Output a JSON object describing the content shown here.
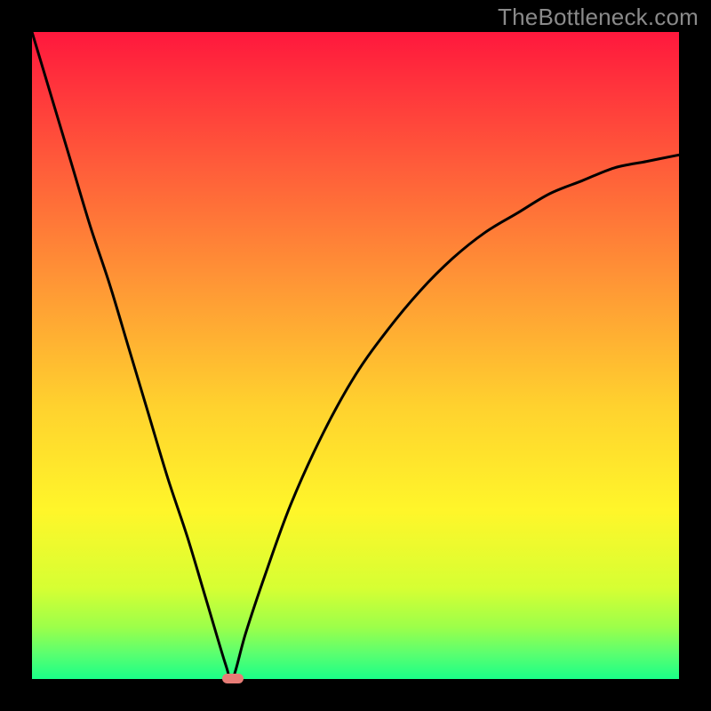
{
  "watermark": "TheBottleneck.com",
  "colors": {
    "frame": "#000000",
    "line": "#000000",
    "marker": "#e77c76",
    "gradient_stops": [
      {
        "offset": 0.0,
        "color": "#ff183d"
      },
      {
        "offset": 0.2,
        "color": "#ff5a3a"
      },
      {
        "offset": 0.4,
        "color": "#ff9a35"
      },
      {
        "offset": 0.58,
        "color": "#ffd22e"
      },
      {
        "offset": 0.74,
        "color": "#fff62a"
      },
      {
        "offset": 0.86,
        "color": "#d6ff33"
      },
      {
        "offset": 0.92,
        "color": "#9cff4a"
      },
      {
        "offset": 0.96,
        "color": "#5cff6f"
      },
      {
        "offset": 1.0,
        "color": "#1aff88"
      }
    ]
  },
  "chart_data": {
    "type": "line",
    "title": "",
    "xlabel": "",
    "ylabel": "",
    "xlim": [
      0,
      100
    ],
    "ylim": [
      0,
      100
    ],
    "grid": false,
    "series": [
      {
        "name": "bottleneck-curve",
        "x": [
          0,
          3,
          6,
          9,
          12,
          15,
          18,
          21,
          24,
          27,
          30,
          31,
          33,
          36,
          40,
          45,
          50,
          55,
          60,
          65,
          70,
          75,
          80,
          85,
          90,
          95,
          100
        ],
        "y": [
          100,
          90,
          80,
          70,
          61,
          51,
          41,
          31,
          22,
          12,
          2,
          0,
          7,
          16,
          27,
          38,
          47,
          54,
          60,
          65,
          69,
          72,
          75,
          77,
          79,
          80,
          81
        ]
      }
    ],
    "annotations": [
      {
        "name": "minimum-marker",
        "x": 31,
        "y": 0
      }
    ]
  }
}
